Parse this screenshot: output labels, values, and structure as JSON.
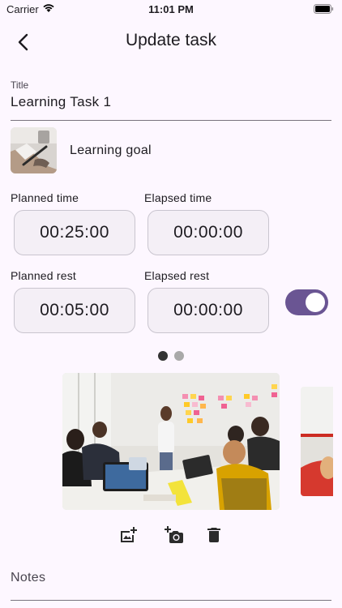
{
  "status_bar": {
    "carrier": "Carrier",
    "time": "11:01 PM"
  },
  "app_bar": {
    "title": "Update task",
    "back_icon": "chevron-left-icon"
  },
  "title_field": {
    "label": "Title",
    "value": "Learning Task 1"
  },
  "goal": {
    "label": "Learning goal"
  },
  "times": {
    "planned_time_label": "Planned time",
    "planned_time": "00:25:00",
    "elapsed_time_label": "Elapsed time",
    "elapsed_time": "00:00:00",
    "planned_rest_label": "Planned rest",
    "planned_rest": "00:05:00",
    "elapsed_rest_label": "Elapsed rest",
    "elapsed_rest": "00:00:00"
  },
  "rest_toggle": {
    "on": true
  },
  "gallery": {
    "page_count": 2,
    "active_page": 0
  },
  "actions": [
    "add-photo-icon",
    "camera-add-icon",
    "trash-icon"
  ],
  "notes": {
    "placeholder": "Notes"
  },
  "colors": {
    "accent": "#6a5593",
    "background": "#fdf7ff",
    "field": "#f4eff6"
  }
}
